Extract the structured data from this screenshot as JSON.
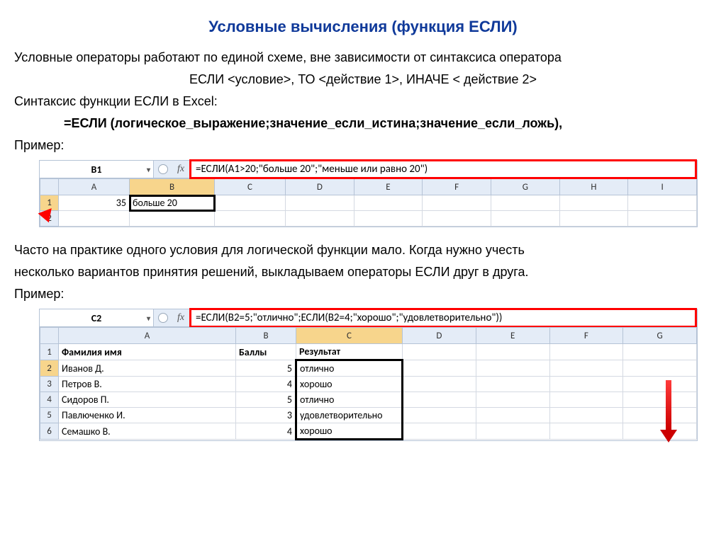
{
  "title": "Условные вычисления (функция ЕСЛИ)",
  "intro": {
    "p1": "Условные операторы работают по единой схеме, вне зависимости от синтаксиса оператора",
    "p2": "ЕСЛИ <условие>, ТО <действие 1>, ИНАЧЕ < действие 2>",
    "p3": "Синтаксис функции ЕСЛИ в Excel:",
    "formula": "=ЕСЛИ (логическое_выражение;значение_если_истина;значение_если_ложь),",
    "example_label": "Пример:"
  },
  "excel1": {
    "namebox": "B1",
    "fx": "fx",
    "formula": "=ЕСЛИ(A1>20;\"больше 20\";\"меньше или равно 20\")",
    "cols": [
      "A",
      "B",
      "C",
      "D",
      "E",
      "F",
      "G",
      "H",
      "I"
    ],
    "rows": [
      "1",
      "2"
    ],
    "data": {
      "A1": "35",
      "B1": "больше 20"
    }
  },
  "middle": {
    "p1": "Часто на практике одного условия для логической функции мало. Когда нужно учесть",
    "p2": "несколько вариантов принятия решений, выкладываем операторы ЕСЛИ друг в друга.",
    "example_label": "Пример:"
  },
  "excel2": {
    "namebox": "C2",
    "fx": "fx",
    "formula": "=ЕСЛИ(B2=5;\"отлично\";ЕСЛИ(B2=4;\"хорошо\";\"удовлетворительно\"))",
    "cols": [
      "A",
      "B",
      "C",
      "D",
      "E",
      "F",
      "G"
    ],
    "rows": [
      "1",
      "2",
      "3",
      "4",
      "5",
      "6"
    ],
    "header": {
      "A": "Фамилия имя",
      "B": "Баллы",
      "C": "Результат"
    },
    "data": [
      {
        "name": "Иванов Д.",
        "score": "5",
        "res": "отлично"
      },
      {
        "name": "Петров В.",
        "score": "4",
        "res": "хорошо"
      },
      {
        "name": "Сидоров П.",
        "score": "5",
        "res": "отлично"
      },
      {
        "name": "Павлюченко И.",
        "score": "3",
        "res": "удовлетворительно"
      },
      {
        "name": "Семашко В.",
        "score": "4",
        "res": "хорошо"
      }
    ]
  }
}
